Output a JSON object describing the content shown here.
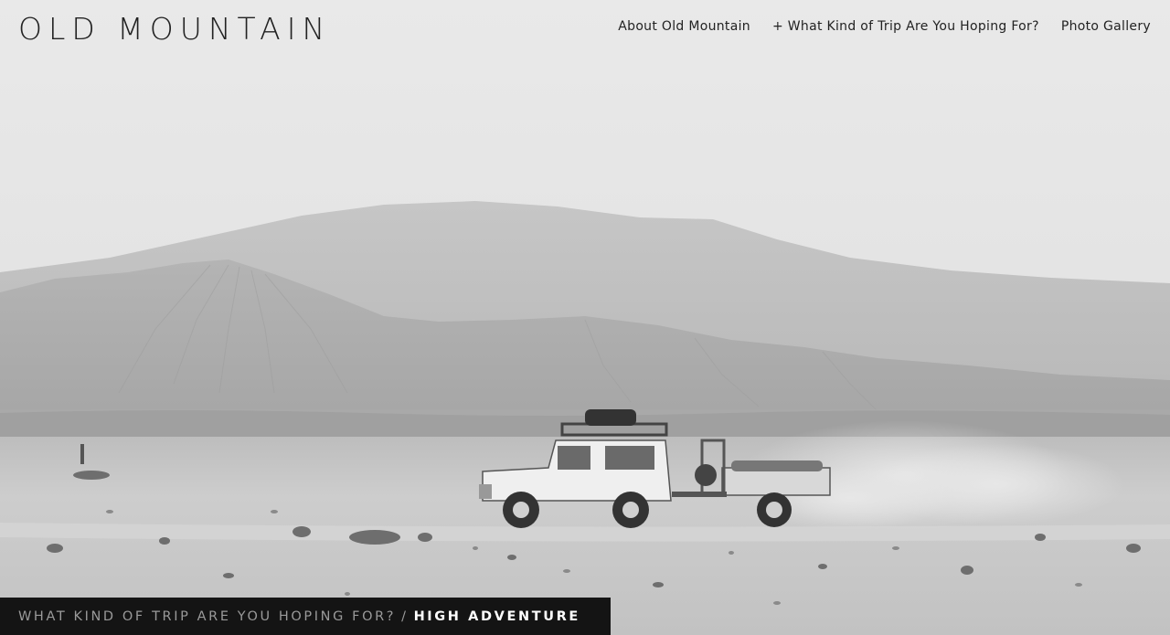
{
  "header": {
    "site_title": "OLD MOUNTAIN"
  },
  "nav": {
    "items": [
      "About Old Mountain",
      "+ What Kind of Trip Are You Hoping For?",
      "Photo Gallery"
    ]
  },
  "caption": {
    "section": "What Kind of Trip Are You Hoping For?",
    "separator": "/",
    "current": "High Adventure"
  },
  "hero": {
    "subject": "vehicle-with-trailer-in-desert"
  }
}
